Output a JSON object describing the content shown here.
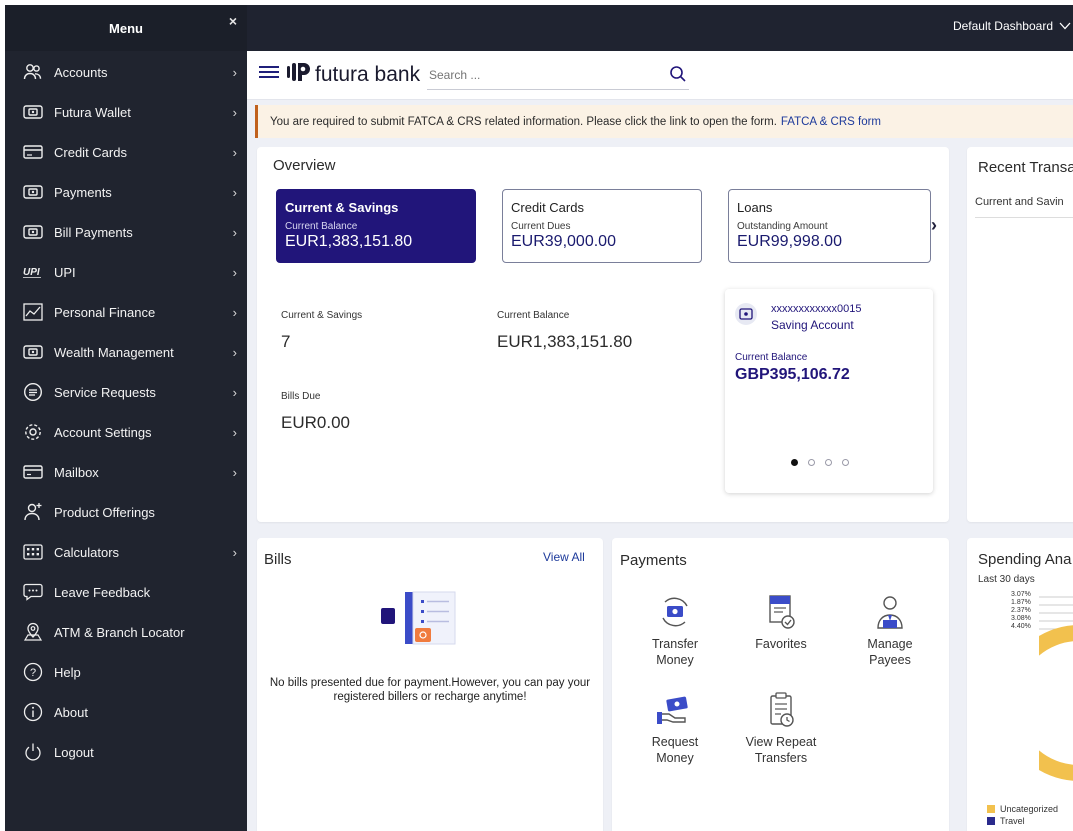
{
  "sidebar": {
    "title": "Menu",
    "close": "×",
    "items": [
      {
        "label": "Accounts",
        "icon": "accounts-icon",
        "has_submenu": true
      },
      {
        "label": "Futura Wallet",
        "icon": "wallet-icon",
        "has_submenu": true
      },
      {
        "label": "Credit Cards",
        "icon": "credit-card-icon",
        "has_submenu": true
      },
      {
        "label": "Payments",
        "icon": "payments-icon",
        "has_submenu": true
      },
      {
        "label": "Bill Payments",
        "icon": "bill-payments-icon",
        "has_submenu": true
      },
      {
        "label": "UPI",
        "icon": "upi-icon",
        "has_submenu": true
      },
      {
        "label": "Personal Finance",
        "icon": "chart-icon",
        "has_submenu": true
      },
      {
        "label": "Wealth Management",
        "icon": "wealth-icon",
        "has_submenu": true
      },
      {
        "label": "Service Requests",
        "icon": "service-icon",
        "has_submenu": true
      },
      {
        "label": "Account Settings",
        "icon": "gear-icon",
        "has_submenu": true
      },
      {
        "label": "Mailbox",
        "icon": "mailbox-icon",
        "has_submenu": true
      },
      {
        "label": "Product Offerings",
        "icon": "user-plus-icon",
        "has_submenu": false
      },
      {
        "label": "Calculators",
        "icon": "calculator-icon",
        "has_submenu": true
      },
      {
        "label": "Leave Feedback",
        "icon": "feedback-icon",
        "has_submenu": false
      },
      {
        "label": "ATM & Branch Locator",
        "icon": "location-icon",
        "has_submenu": false
      },
      {
        "label": "Help",
        "icon": "help-icon",
        "has_submenu": false
      },
      {
        "label": "About",
        "icon": "info-icon",
        "has_submenu": false
      },
      {
        "label": "Logout",
        "icon": "power-icon",
        "has_submenu": false
      }
    ]
  },
  "topbar": {
    "dashboard_select": "Default Dashboard"
  },
  "header": {
    "logo_text": "futura bank",
    "search_placeholder": "Search ..."
  },
  "notice": {
    "text": "You are required to submit FATCA & CRS related information. Please click the link to open the form.",
    "link": "FATCA & CRS form"
  },
  "overview": {
    "title": "Overview",
    "tabs": [
      {
        "title": "Current & Savings",
        "sub": "Current Balance",
        "value": "EUR1,383,151.80",
        "active": true
      },
      {
        "title": "Credit Cards",
        "sub": "Current Dues",
        "value": "EUR39,000.00",
        "active": false
      },
      {
        "title": "Loans",
        "sub": "Outstanding Amount",
        "value": "EUR99,998.00",
        "active": false
      }
    ],
    "stats": {
      "savings_label": "Current & Savings",
      "savings_value": "7",
      "balance_label": "Current Balance",
      "balance_value": "EUR1,383,151.80",
      "bills_label": "Bills Due",
      "bills_value": "EUR0.00"
    },
    "account_card": {
      "number": "xxxxxxxxxxxx0015",
      "type": "Saving Account",
      "balance_label": "Current Balance",
      "balance": "GBP395,106.72",
      "dots": 4,
      "active_dot": 1
    }
  },
  "recent": {
    "title": "Recent Transa",
    "sub": "Current and Savin"
  },
  "bills": {
    "title": "Bills",
    "view_all": "View All",
    "message": "No bills presented due for payment.However, you can pay your registered billers or recharge anytime!"
  },
  "payments": {
    "title": "Payments",
    "items": [
      {
        "label_1": "Transfer",
        "label_2": "Money",
        "icon": "transfer-money-icon"
      },
      {
        "label_1": "Favorites",
        "label_2": "",
        "icon": "favorites-icon"
      },
      {
        "label_1": "Manage",
        "label_2": "Payees",
        "icon": "manage-payees-icon"
      },
      {
        "label_1": "Request",
        "label_2": "Money",
        "icon": "request-money-icon"
      },
      {
        "label_1": "View Repeat",
        "label_2": "Transfers",
        "icon": "repeat-transfers-icon"
      }
    ]
  },
  "spending": {
    "title": "Spending Ana",
    "period": "Last 30 days",
    "percentages": [
      "3.07%",
      "1.87%",
      "2.37%",
      "3.08%",
      "4.40%"
    ],
    "legend": [
      {
        "label": "Uncategorized",
        "color": "#f2c14e"
      },
      {
        "label": "Travel",
        "color": "#2a2a8c"
      }
    ]
  },
  "colors": {
    "primary": "#21157a",
    "sidebar": "#20242f",
    "link": "#1d3a9b",
    "notice": "#fbf2e5"
  }
}
